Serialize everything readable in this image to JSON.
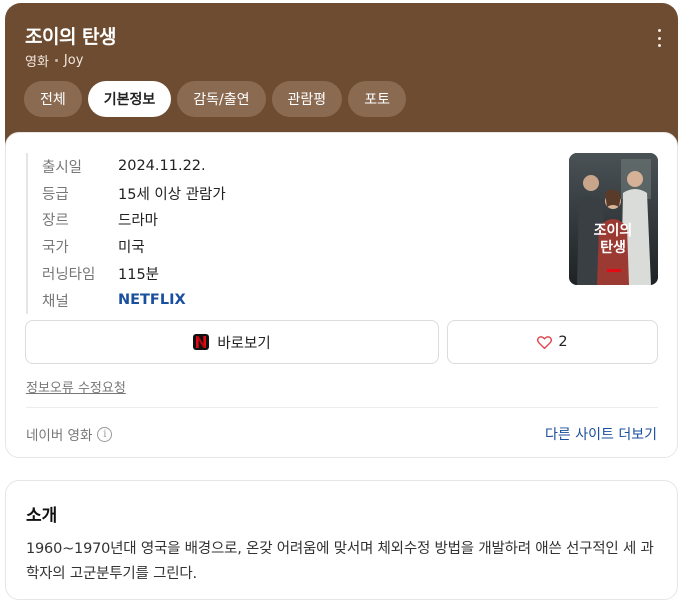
{
  "header": {
    "title": "조이의 탄생",
    "category": "영화",
    "english_title": "Joy",
    "bg_color": "#6e4c31"
  },
  "tabs": [
    {
      "label": "전체",
      "active": false
    },
    {
      "label": "기본정보",
      "active": true
    },
    {
      "label": "감독/출연",
      "active": false
    },
    {
      "label": "관람평",
      "active": false
    },
    {
      "label": "포토",
      "active": false
    }
  ],
  "info": {
    "release_label": "출시일",
    "release_value": "2024.11.22.",
    "rating_label": "등급",
    "rating_value": "15세 이상 관람가",
    "genre_label": "장르",
    "genre_value": "드라마",
    "country_label": "국가",
    "country_value": "미국",
    "runtime_label": "러닝타임",
    "runtime_value": "115분",
    "channel_label": "채널",
    "channel_value": "NETFLIX"
  },
  "poster": {
    "title_line1": "조이의",
    "title_line2": "탄생"
  },
  "actions": {
    "watch_label": "바로보기",
    "like_count": "2"
  },
  "footer": {
    "report_label": "정보오류 수정요청",
    "source_label": "네이버 영화",
    "other_sites_label": "다른 사이트 더보기"
  },
  "intro": {
    "title": "소개",
    "body": "1960~1970년대 영국을 배경으로, 온갖 어려움에 맞서며 체외수정 방법을 개발하려 애쓴 선구적인 세 과학자의 고군분투기를 그린다."
  },
  "colors": {
    "link": "#1a4e9e",
    "netflix_red": "#e50914",
    "heart": "#e0424a"
  }
}
